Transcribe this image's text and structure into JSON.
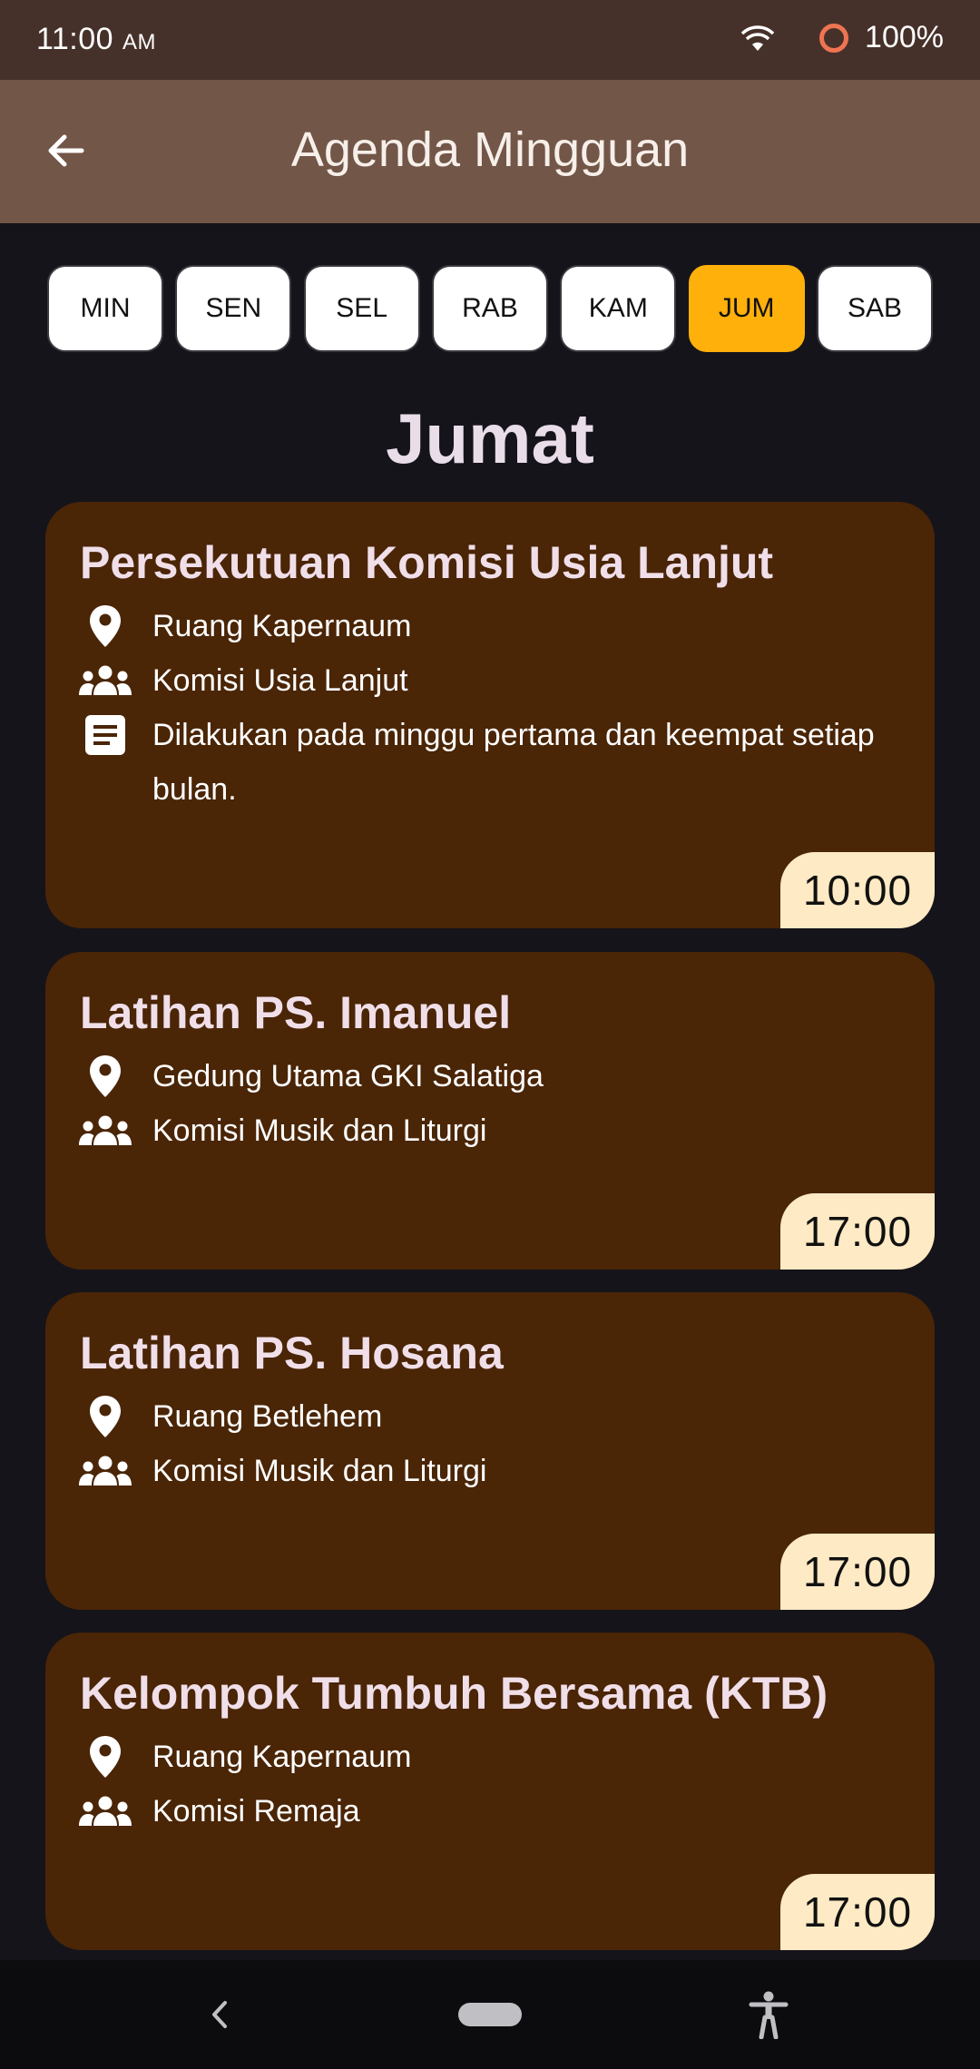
{
  "status_bar": {
    "time": "11:00",
    "ampm": "AM",
    "battery": "100%",
    "icons": [
      "wifi-icon",
      "battery-ring-icon"
    ]
  },
  "app_bar": {
    "title": "Agenda Mingguan",
    "back_icon": "arrow-left-icon"
  },
  "days": {
    "items": [
      "MIN",
      "SEN",
      "SEL",
      "RAB",
      "KAM",
      "JUM",
      "SAB"
    ],
    "selected": "JUM",
    "active_color": "#ffb00b"
  },
  "heading": "Jumat",
  "agenda": [
    {
      "title": "Persekutuan Komisi Usia Lanjut",
      "location": "Ruang Kapernaum",
      "group": "Komisi Usia Lanjut",
      "note": "Dilakukan pada minggu pertama dan keempat setiap bulan.",
      "time": "10:00"
    },
    {
      "title": "Latihan PS. Imanuel",
      "location": "Gedung Utama GKI Salatiga",
      "group": "Komisi Musik dan Liturgi",
      "time": "17:00"
    },
    {
      "title": "Latihan PS. Hosana",
      "location": "Ruang Betlehem",
      "group": "Komisi Musik dan Liturgi",
      "time": "17:00"
    },
    {
      "title": "Kelompok Tumbuh Bersama (KTB)",
      "location": "Ruang Kapernaum",
      "group": "Komisi Remaja",
      "time": "17:00"
    }
  ],
  "colors": {
    "status_bar": "#46312a",
    "app_bar": "#725648",
    "background": "#15141b",
    "card": "#4a2506",
    "time_badge": "#feeac4"
  },
  "nav_bar": {
    "icons": [
      "nav-back-icon",
      "home-pill-icon",
      "accessibility-icon"
    ]
  }
}
